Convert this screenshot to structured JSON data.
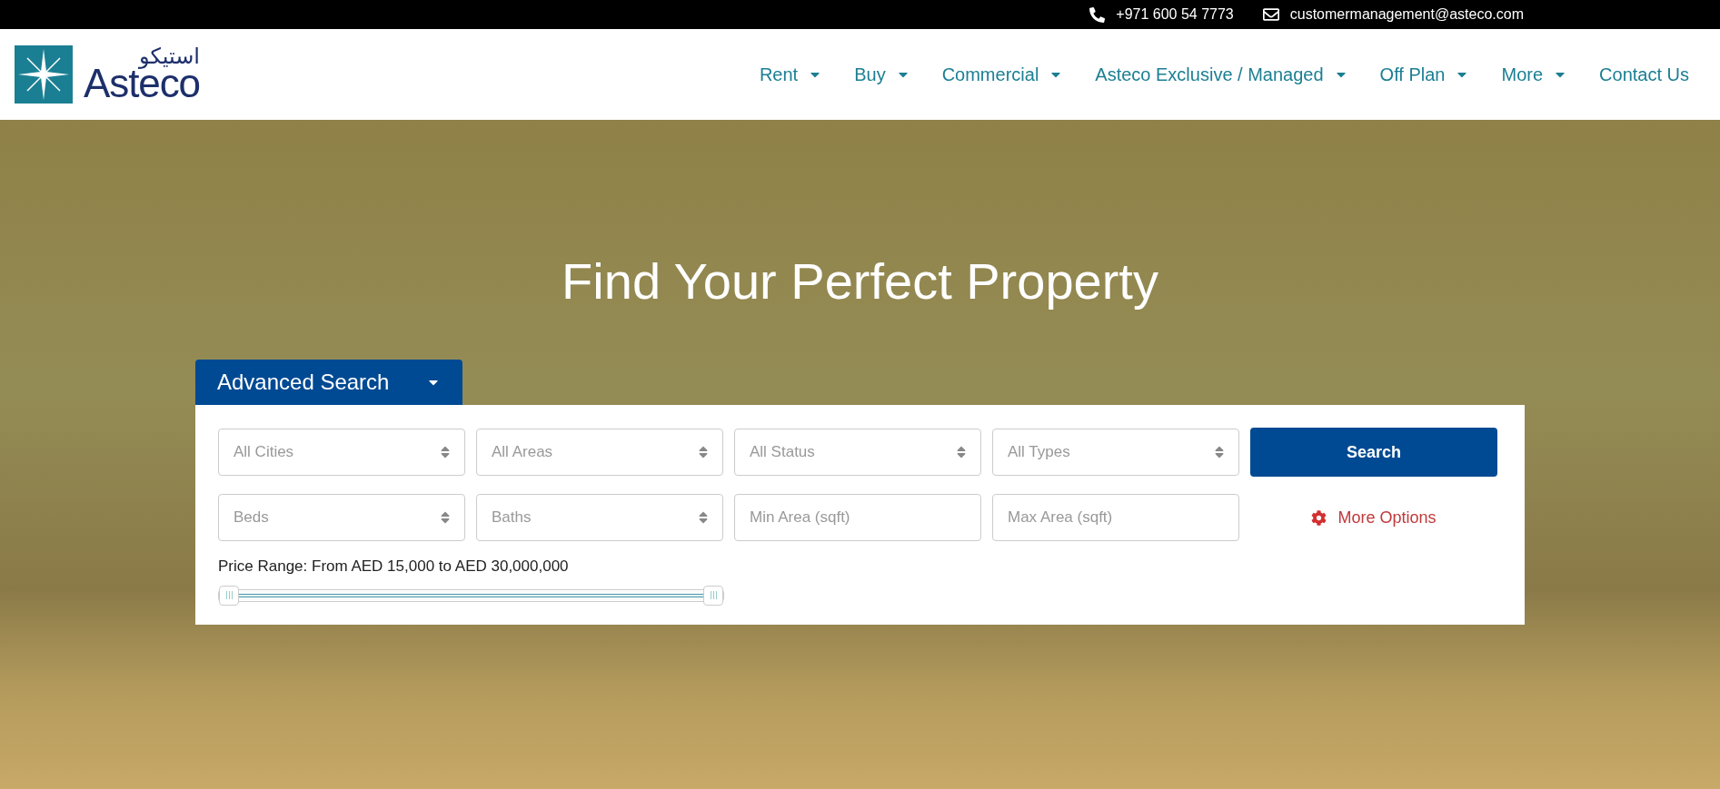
{
  "top_bar": {
    "phone": "+971 600 54 7773",
    "email": "customermanagement@asteco.com"
  },
  "logo": {
    "arabic": "استيكو",
    "name": "Asteco"
  },
  "nav": [
    {
      "label": "Rent",
      "dropdown": true
    },
    {
      "label": "Buy",
      "dropdown": true
    },
    {
      "label": "Commercial",
      "dropdown": true
    },
    {
      "label": "Asteco Exclusive / Managed",
      "dropdown": true
    },
    {
      "label": "Off Plan",
      "dropdown": true
    },
    {
      "label": "More",
      "dropdown": true
    },
    {
      "label": "Contact Us",
      "dropdown": false
    }
  ],
  "hero": {
    "title": "Find Your Perfect Property"
  },
  "search": {
    "tab": "Advanced Search",
    "expanded": true,
    "fields": [
      {
        "kind": "select",
        "placeholder": "All Cities"
      },
      {
        "kind": "select",
        "placeholder": "All Areas"
      },
      {
        "kind": "select",
        "placeholder": "All Status"
      },
      {
        "kind": "select",
        "placeholder": "All Types"
      },
      {
        "kind": "select",
        "placeholder": "Beds"
      },
      {
        "kind": "select",
        "placeholder": "Baths"
      },
      {
        "kind": "input",
        "placeholder": "Min Area (sqft)"
      },
      {
        "kind": "input",
        "placeholder": "Max Area (sqft)"
      }
    ],
    "button": "Search",
    "more_options": "More Options",
    "price_range": {
      "label": "Price Range: From AED 15,000 to AED 30,000,000",
      "level": 1
    }
  }
}
